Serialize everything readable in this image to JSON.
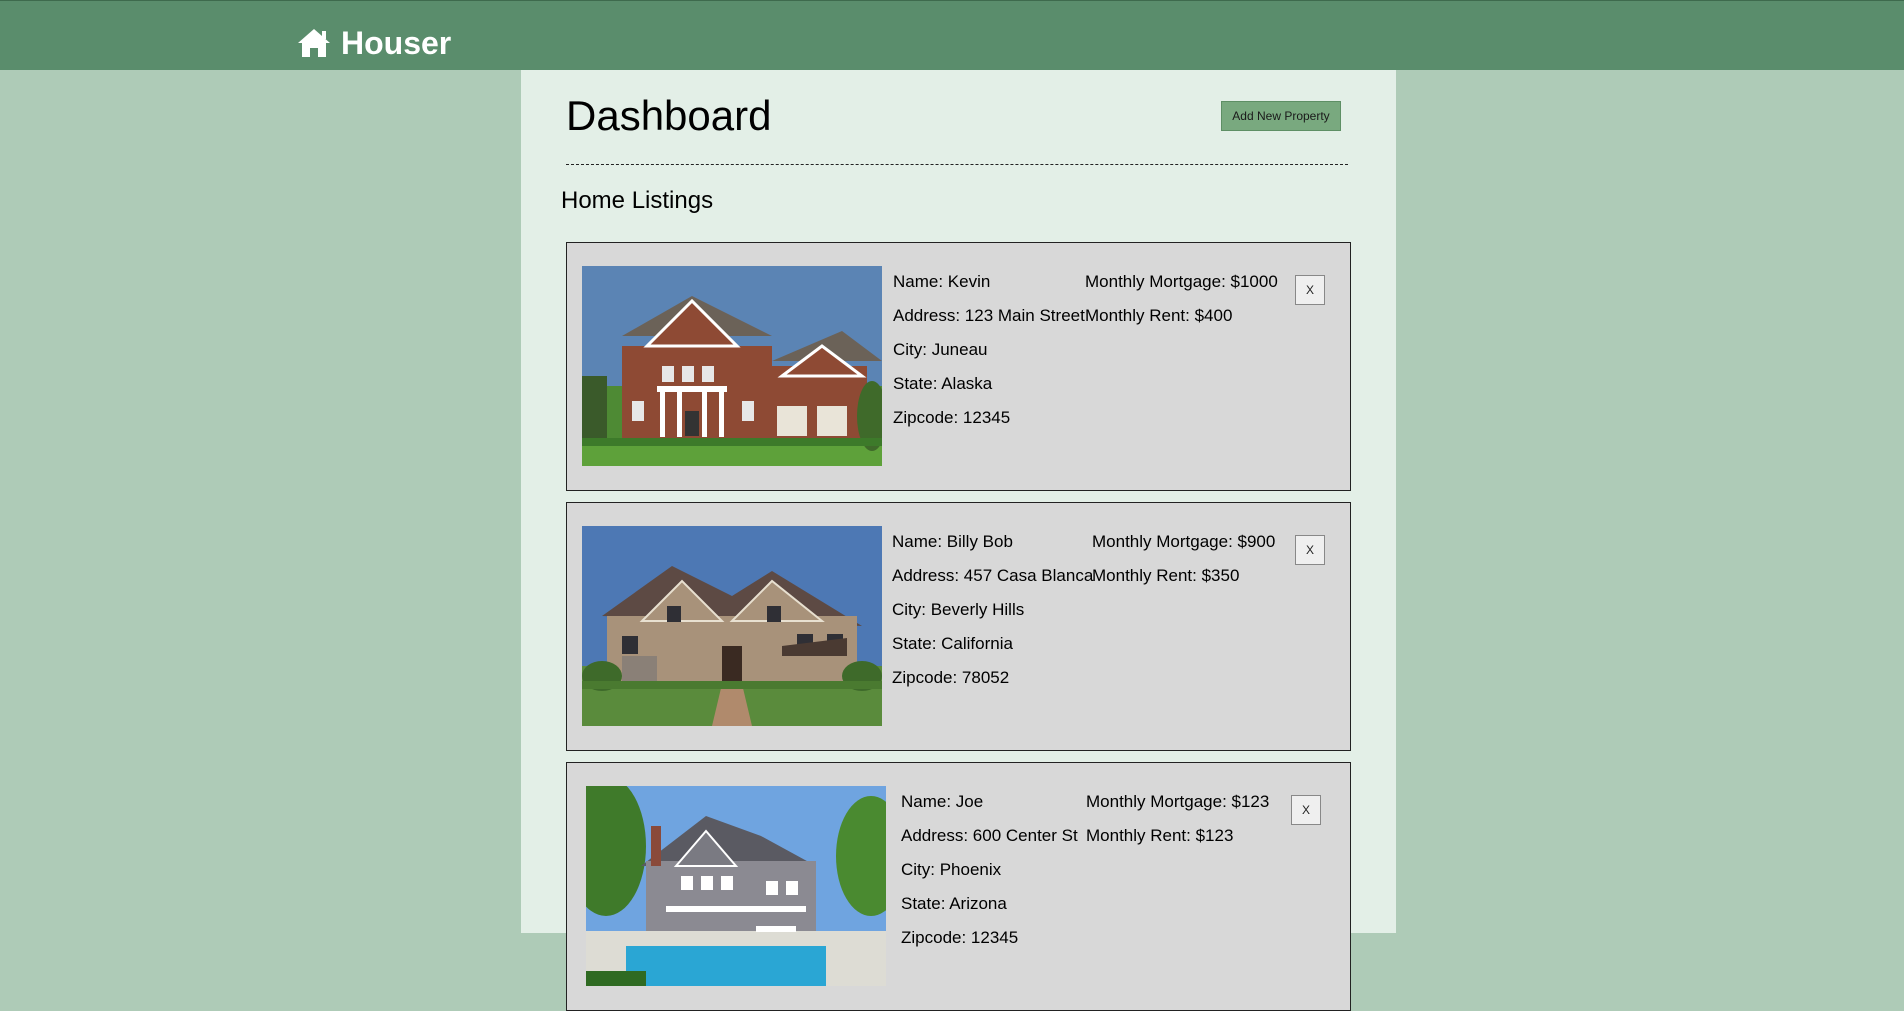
{
  "header": {
    "brand_name": "Houser",
    "brand_icon": "home-icon",
    "colors": {
      "bar": "#5a8d6c",
      "page_bg": "#aecbb7",
      "panel_bg": "#e3efe7",
      "card_bg": "#d8d8d8",
      "button": "#79a97f"
    }
  },
  "dashboard": {
    "title": "Dashboard",
    "add_button_label": "Add New Property",
    "divider": "-------------------------------------------------------------------------------------------------------",
    "section_title": "Home Listings"
  },
  "listings": [
    {
      "name": "Name: Kevin",
      "address": "Address: 123 Main Street",
      "city": "City: Juneau",
      "state": "State: Alaska",
      "zipcode": "Zipcode: 12345",
      "mortgage": "Monthly Mortgage: $1000",
      "rent": "Monthly Rent: $400",
      "delete_label": "X",
      "image": "brick-colonial-house-photo"
    },
    {
      "name": "Name: Billy Bob",
      "address": "Address: 457 Casa Blanca",
      "city": "City: Beverly Hills",
      "state": "State: California",
      "zipcode": "Zipcode: 78052",
      "mortgage": "Monthly Mortgage: $900",
      "rent": "Monthly Rent: $350",
      "delete_label": "X",
      "image": "stone-two-story-house-photo"
    },
    {
      "name": "Name: Joe",
      "address": "Address: 600 Center St",
      "city": "City: Phoenix",
      "state": "State: Arizona",
      "zipcode": "Zipcode: 12345",
      "mortgage": "Monthly Mortgage: $123",
      "rent": "Monthly Rent: $123",
      "delete_label": "X",
      "image": "shingle-house-with-pool-photo"
    }
  ]
}
